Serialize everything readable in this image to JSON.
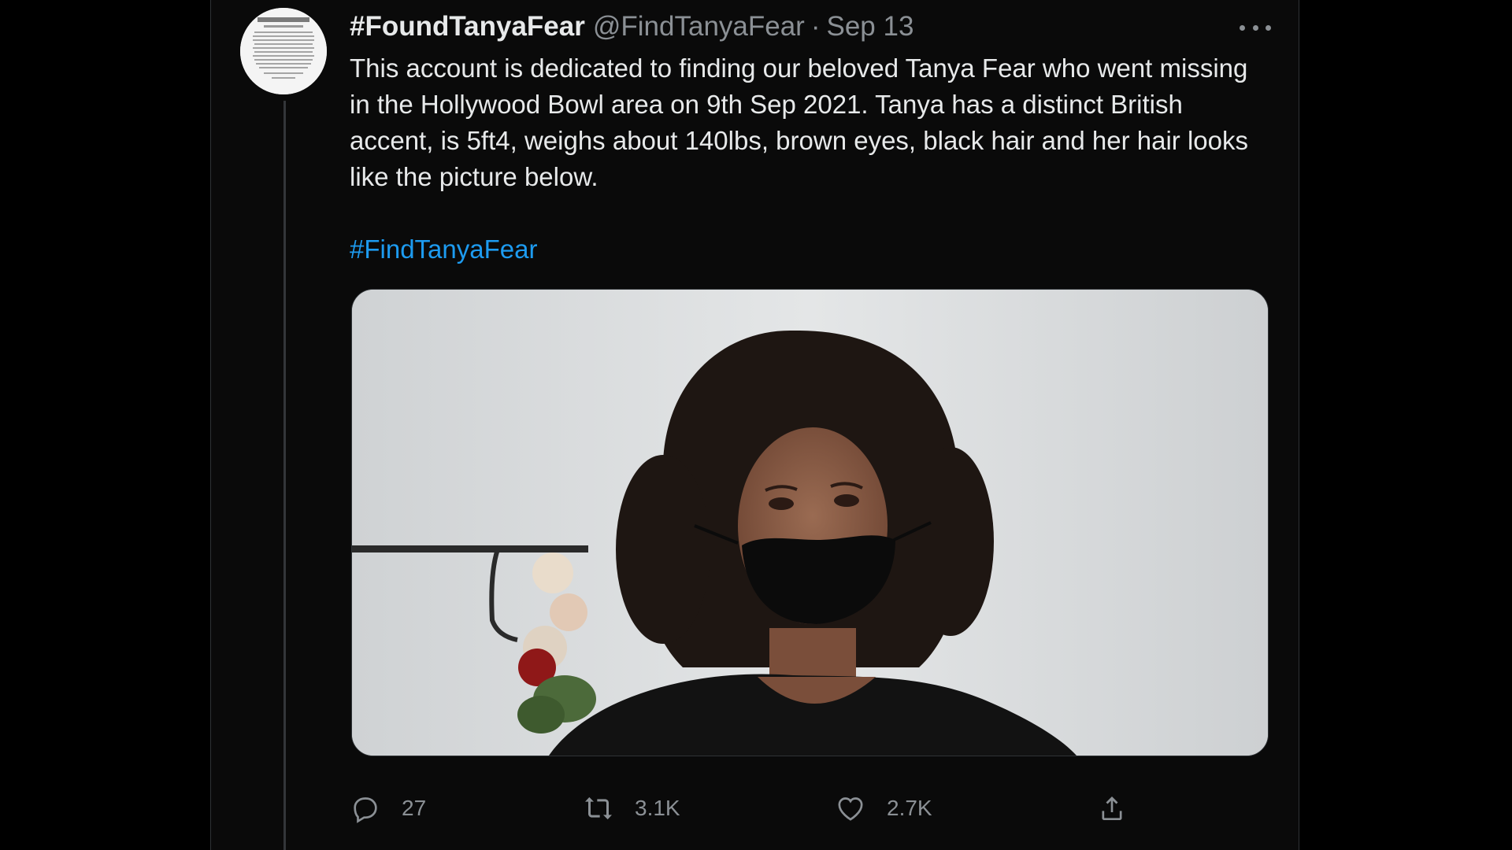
{
  "tweet": {
    "display_name": "#FoundTanyaFear",
    "handle": "@FindTanyaFear",
    "separator": "·",
    "date": "Sep 13",
    "text": "This account is dedicated to finding our beloved Tanya Fear who went missing in the Hollywood Bowl area on 9th Sep 2021. Tanya has a distinct British accent, is 5ft4, weighs about 140lbs, brown eyes, black hair and her hair looks like the picture below.",
    "hashtag": "#FindTanyaFear",
    "media_description": "photo-woman-curly-hair-black-face-mask"
  },
  "actions": {
    "reply": {
      "icon": "reply-icon",
      "count": "27"
    },
    "retweet": {
      "icon": "retweet-icon",
      "count": "3.1K"
    },
    "like": {
      "icon": "heart-icon",
      "count": "2.7K"
    },
    "share": {
      "icon": "share-icon"
    }
  },
  "colors": {
    "background": "#000000",
    "text": "#e7e9ea",
    "secondary": "#8b9095",
    "link": "#1d9bf0"
  }
}
